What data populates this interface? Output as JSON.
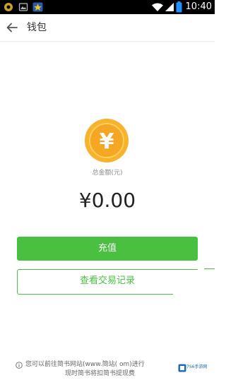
{
  "status_bar": {
    "time": "10:40",
    "left_icons": [
      "android-debug-icon",
      "image-notification-icon",
      "star-app-icon"
    ],
    "right_icons": [
      "wifi-icon",
      "signal-icon",
      "battery-icon"
    ]
  },
  "app_bar": {
    "back_icon": "arrow-left-icon",
    "title": "钱包"
  },
  "wallet": {
    "coin_icon": "yen-coin-icon",
    "coin_symbol": "¥",
    "total_label": "总金额(元)",
    "balance": "¥0.00"
  },
  "buttons": {
    "recharge": "充值",
    "records": "查看交易记录"
  },
  "notice": {
    "line1": "您可以前往简书网站(www.简站(      om)进行",
    "line2": "现时简书将扣简书提现费"
  },
  "colors": {
    "accent_green": "#4ac041",
    "coin_gold": "#f5a623",
    "status_bar": "#000000"
  },
  "watermark": {
    "text": "7S6手游网"
  }
}
